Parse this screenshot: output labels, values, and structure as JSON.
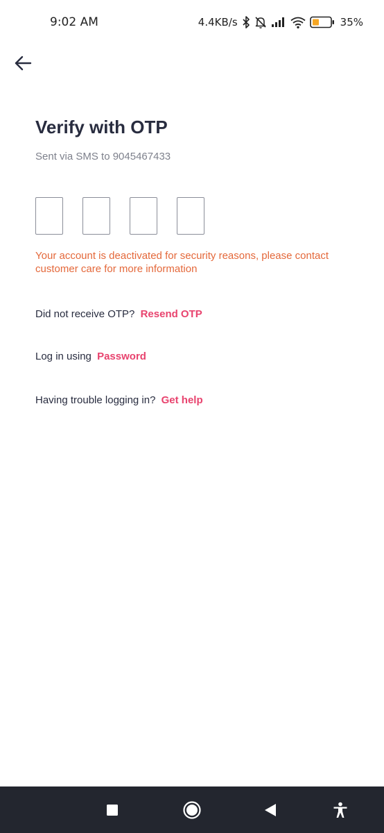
{
  "status_bar": {
    "time": "9:02 AM",
    "net_speed": "4.4KB/s",
    "battery": "35%",
    "icons": [
      "bluetooth-icon",
      "mute-icon",
      "signal-icon",
      "wifi-icon",
      "battery-icon"
    ],
    "battery_color": "#f5a623"
  },
  "header": {
    "back_icon": "arrow-left-icon"
  },
  "main": {
    "title": "Verify with OTP",
    "subtitle": "Sent via SMS to 9045467433",
    "otp": {
      "boxes": [
        "",
        "",
        "",
        ""
      ]
    },
    "error_message": "Your account is deactivated for security reasons, please contact customer care for more information",
    "resend": {
      "prompt": "Did not receive OTP?",
      "link": "Resend OTP"
    },
    "password_login": {
      "prompt": "Log in using",
      "link": "Password"
    },
    "help": {
      "prompt": "Having trouble logging in?",
      "link": "Get help"
    }
  },
  "colors": {
    "text_primary": "#282c3f",
    "text_secondary": "#7e818c",
    "error": "#e4683a",
    "link": "#e8436e",
    "nav_bar": "#23262f"
  },
  "nav_bar": {
    "icons": [
      "recents-square-icon",
      "home-circle-icon",
      "back-triangle-icon",
      "accessibility-icon"
    ]
  }
}
